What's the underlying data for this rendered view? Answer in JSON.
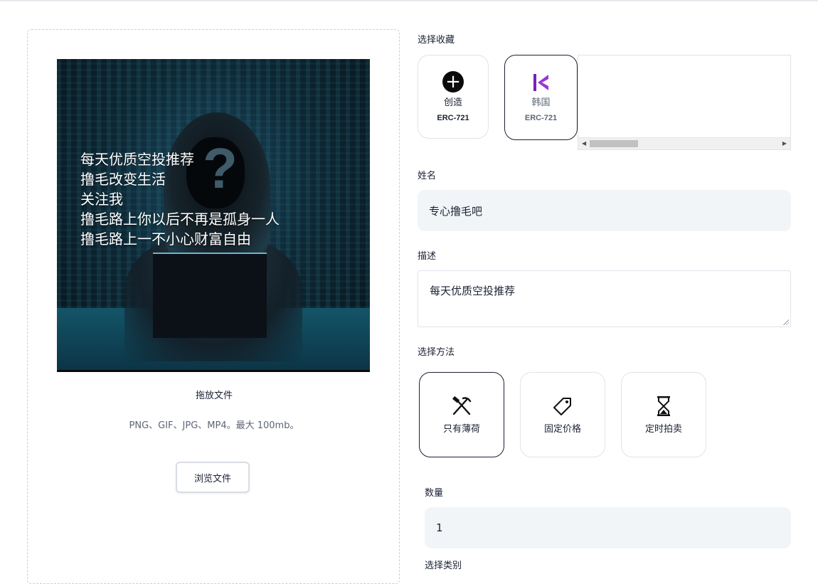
{
  "upload": {
    "image_caption_lines": [
      "每天优质空投推荐",
      "撸毛改变生活",
      "关注我",
      "撸毛路上你以后不再是孤身一人",
      "撸毛路上一不小心财富自由"
    ],
    "drop_label": "拖放文件",
    "formats_text": "PNG、GIF、JPG、MP4。最大 100mb。",
    "browse_button": "浏览文件"
  },
  "form": {
    "collection_label": "选择收藏",
    "collections": [
      {
        "title": "创造",
        "standard": "ERC-721",
        "icon": "plus-circle-icon"
      },
      {
        "title": "韩国",
        "standard": "ERC-721",
        "icon": "kyber-logo-icon",
        "accent": "#8a2be2"
      }
    ],
    "name_label": "姓名",
    "name_value": "专心撸毛吧",
    "description_label": "描述",
    "description_value": "每天优质空投推荐",
    "method_label": "选择方法",
    "methods": [
      {
        "name": "只有薄荷",
        "icon": "pickaxe-hammer-icon",
        "selected": true
      },
      {
        "name": "固定价格",
        "icon": "price-tag-icon",
        "selected": false
      },
      {
        "name": "定时拍卖",
        "icon": "hourglass-icon",
        "selected": false
      }
    ],
    "quantity_label": "数量",
    "quantity_value": "1",
    "category_label": "选择类别"
  }
}
